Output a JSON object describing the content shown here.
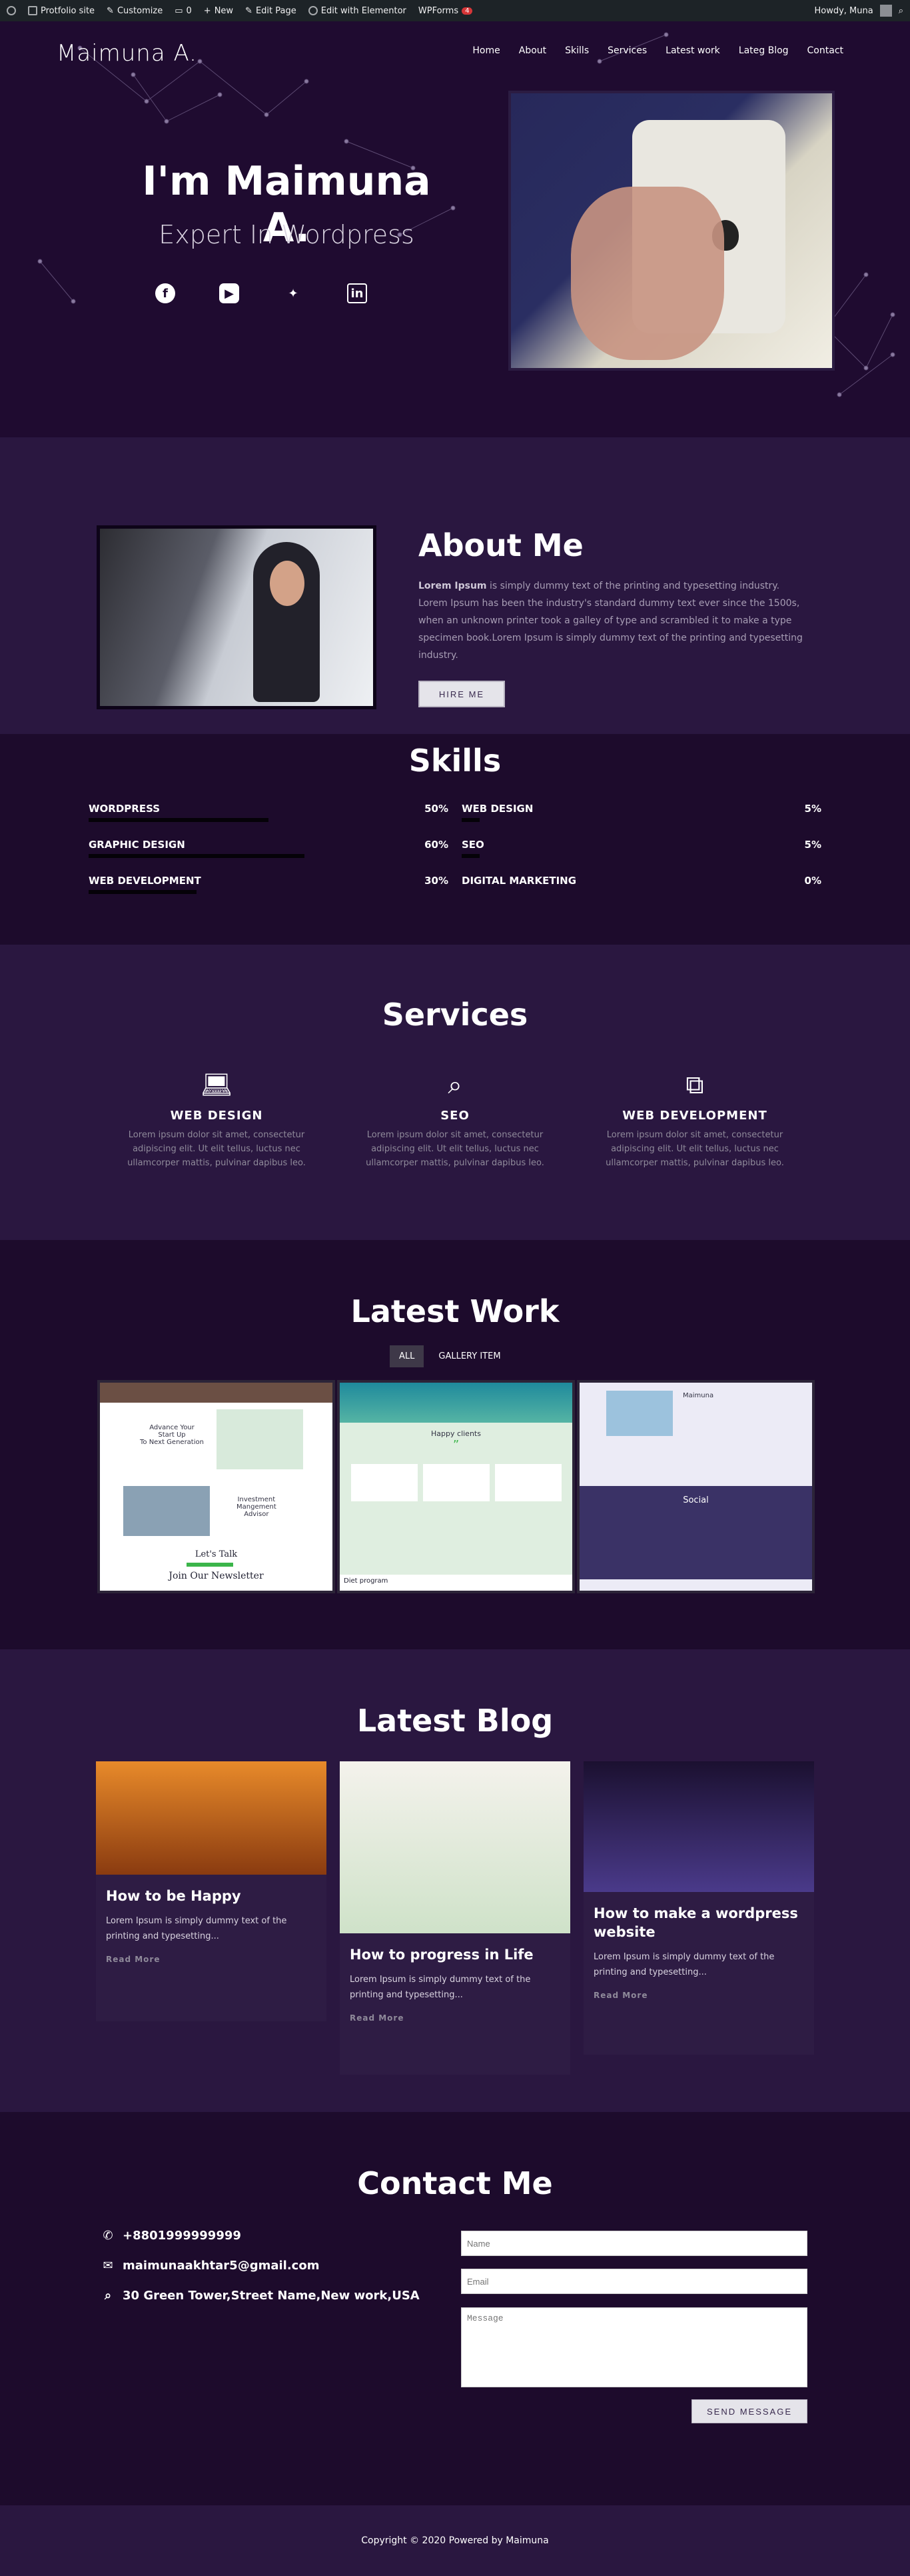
{
  "adminbar": {
    "site": "Protfolio site",
    "customize": "Customize",
    "comments": "0",
    "new": "New",
    "edit_page": "Edit Page",
    "elementor": "Edit with Elementor",
    "wpforms": "WPForms",
    "wpforms_count": "4",
    "howdy": "Howdy, Muna"
  },
  "nav": {
    "logo": "Maimuna A.",
    "items": [
      "Home",
      "About",
      "Skills",
      "Services",
      "Latest work",
      "Lateg Blog",
      "Contact"
    ]
  },
  "hero": {
    "title": "I'm Maimuna A.",
    "subtitle": "Expert In Wordpress",
    "socials": [
      "facebook-icon",
      "youtube-icon",
      "twitter-icon",
      "linkedin-icon"
    ]
  },
  "about": {
    "title": "About Me",
    "lead": "Lorem Ipsum",
    "text": " is simply dummy text of the printing and typesetting industry. Lorem Ipsum has been the industry's standard dummy text ever since the 1500s, when an unknown printer took a galley of type and scrambled it to make a type specimen book.Lorem Ipsum is simply dummy text of the printing and typesetting industry.",
    "button": "HIRE ME"
  },
  "skills": {
    "title": "Skills",
    "items": [
      {
        "name": "WORDPRESS",
        "percent": "50%",
        "value": 50
      },
      {
        "name": "WEB DESIGN",
        "percent": "5%",
        "value": 5
      },
      {
        "name": "GRAPHIC DESIGN",
        "percent": "60%",
        "value": 60
      },
      {
        "name": "SEO",
        "percent": "5%",
        "value": 5
      },
      {
        "name": "WEB DEVELOPMENT",
        "percent": "30%",
        "value": 30
      },
      {
        "name": "DIGITAL MARKETING",
        "percent": "0%",
        "value": 0
      }
    ]
  },
  "services": {
    "title": "Services",
    "items": [
      {
        "icon": "laptop-icon",
        "title": "WEB DESIGN",
        "text": "Lorem ipsum dolor sit amet, consectetur adipiscing elit. Ut elit tellus, luctus nec ullamcorper mattis, pulvinar dapibus leo."
      },
      {
        "icon": "search-icon",
        "title": "SEO",
        "text": "Lorem ipsum dolor sit amet, consectetur adipiscing elit. Ut elit tellus, luctus nec ullamcorper mattis, pulvinar dapibus leo."
      },
      {
        "icon": "code-monitor-icon",
        "title": "WEB DEVELOPMENT",
        "text": "Lorem ipsum dolor sit amet, consectetur adipiscing elit. Ut elit tellus, luctus nec ullamcorper mattis, pulvinar dapibus leo."
      }
    ]
  },
  "work": {
    "title": "Latest Work",
    "filters": [
      "ALL",
      "GALLERY ITEM"
    ],
    "card1": {
      "line1": "Advance Your",
      "line2": "Start Up",
      "line3": "To Next Generation",
      "advisor1": "Investment",
      "advisor2": "Mangement",
      "advisor3": "Advisor",
      "talk": "Let's Talk",
      "newsletter": "Join Our Newsletter"
    },
    "card2": {
      "heading": "Happy clients",
      "quote": "”",
      "footer": "Diet program"
    },
    "card3": {
      "name": "Maimuna",
      "social": "Social"
    }
  },
  "blog": {
    "title": "Latest Blog",
    "posts": [
      {
        "title": "How to be Happy",
        "text": "Lorem Ipsum is simply dummy text of the printing and typesetting...",
        "more": "Read More"
      },
      {
        "title": "How to progress in Life",
        "text": "Lorem Ipsum is simply dummy text of the printing and typesetting...",
        "more": "Read More"
      },
      {
        "title": "How to make a wordpress website",
        "text": "Lorem Ipsum is simply dummy text of the printing and typesetting...",
        "more": "Read More"
      }
    ]
  },
  "contact": {
    "title": "Contact Me",
    "phone": "+8801999999999",
    "email": "maimunaakhtar5@gmail.com",
    "address": "30 Green Tower,Street Name,New work,USA",
    "name_ph": "Name",
    "email_ph": "Email",
    "message_ph": "Message",
    "button": "SEND MESSAGE"
  },
  "footer": {
    "text": "Copyright © 2020 Powered by Maimuna"
  }
}
